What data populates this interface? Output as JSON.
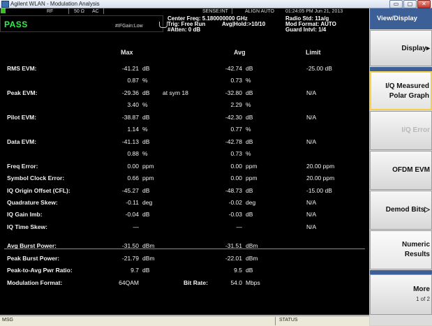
{
  "window": {
    "title": "Agilent WLAN - Modulation Analysis",
    "btn_min": "▭",
    "btn_max": "▢",
    "btn_close": "✕"
  },
  "header": {
    "rf": "RF",
    "impedance": "50 Ω",
    "coupling": "AC",
    "sense": "SENSE:INT",
    "align": "ALIGN AUTO",
    "datetime": "01:24:05 PM Jun 21, 2013",
    "pass_text": "PASS",
    "if_gain": "#IFGain:Low",
    "center_freq": "Center Freq: 5.180000000 GHz",
    "trig": "Trig: Free Run",
    "avg_hold": "Avg|Hold:>10/10",
    "atten": "#Atten: 0 dB",
    "radio_std": "Radio Std: 11a/g",
    "mod_format": "Mod Format: AUTO",
    "guard": "Guard Intvl: 1/4",
    "accent_green": "#2ff04a"
  },
  "columns": {
    "max": "Max",
    "avg": "Avg",
    "limit": "Limit"
  },
  "rows": [
    {
      "label": "RMS EVM:",
      "max": "-41.21",
      "max_u": "dB",
      "avg": "-42.74",
      "avg_u": "dB",
      "limit": "-25.00 dB"
    },
    {
      "label": "",
      "max": "0.87",
      "max_u": "%",
      "avg": "0.73",
      "avg_u": "%",
      "limit": ""
    },
    {
      "label": "Peak EVM:",
      "max": "-29.36",
      "max_u": "dB",
      "extra": "at   sym   18",
      "avg": "-32.80",
      "avg_u": "dB",
      "limit": "N/A"
    },
    {
      "label": "",
      "max": "3.40",
      "max_u": "%",
      "avg": "2.29",
      "avg_u": "%",
      "limit": ""
    },
    {
      "label": "Pilot EVM:",
      "max": "-38.87",
      "max_u": "dB",
      "avg": "-42.30",
      "avg_u": "dB",
      "limit": "N/A"
    },
    {
      "label": "",
      "max": "1.14",
      "max_u": "%",
      "avg": "0.77",
      "avg_u": "%",
      "limit": ""
    },
    {
      "label": "Data EVM:",
      "max": "-41.13",
      "max_u": "dB",
      "avg": "-42.78",
      "avg_u": "dB",
      "limit": "N/A"
    },
    {
      "label": "",
      "max": "0.88",
      "max_u": "%",
      "avg": "0.73",
      "avg_u": "%",
      "limit": ""
    },
    {
      "label": "Freq Error:",
      "max": "0.00",
      "max_u": "ppm",
      "avg": "0.00",
      "avg_u": "ppm",
      "limit": "20.00   ppm"
    },
    {
      "label": "Symbol Clock Error:",
      "max": "0.66",
      "max_u": "ppm",
      "avg": "0.00",
      "avg_u": "ppm",
      "limit": "20.00   ppm"
    },
    {
      "label": "IQ Origin Offset (CFL):",
      "max": "-45.27",
      "max_u": "dB",
      "avg": "-48.73",
      "avg_u": "dB",
      "limit": "-15.00 dB"
    },
    {
      "label": "Quadrature Skew:",
      "max": "-0.11",
      "max_u": "deg",
      "avg": "-0.02",
      "avg_u": "deg",
      "limit": "N/A"
    },
    {
      "label": "IQ Gain Imb:",
      "max": "-0.04",
      "max_u": "dB",
      "avg": "-0.03",
      "avg_u": "dB",
      "limit": "N/A"
    },
    {
      "label": "IQ Time Skew:",
      "max": "—",
      "max_u": "",
      "avg": "—",
      "avg_u": "",
      "limit": "N/A"
    },
    {
      "label": "Avg Burst Power:",
      "max": "-31.50",
      "max_u": "dBm",
      "avg": "-31.51",
      "avg_u": "dBm",
      "limit": ""
    },
    {
      "label": "Peak Burst Power:",
      "max": "-21.79",
      "max_u": "dBm",
      "avg": "-22.01",
      "avg_u": "dBm",
      "limit": ""
    },
    {
      "label": "Peak-to-Avg Pwr Ratio:",
      "max": "9.7",
      "max_u": "dB",
      "avg": "9.5",
      "avg_u": "dB",
      "limit": ""
    },
    {
      "label": "Modulation Format:",
      "max": "64QAM",
      "max_u": "",
      "bitrate_label": "Bit Rate:",
      "avg": "54.0",
      "avg_u": "Mbps",
      "limit": ""
    }
  ],
  "statusbar": {
    "msg": "MSG",
    "status": "STATUS"
  },
  "softkeys": {
    "title": "View/Display",
    "display": "Display▸",
    "iq_line1": "I/Q Measured",
    "iq_line2": "Polar Graph",
    "iq_error": "I/Q Error",
    "ofdm_evm": "OFDM EVM",
    "demod_bits": "Demod Bits▷",
    "numeric_line1": "Numeric",
    "numeric_line2": "Results",
    "more": "More",
    "more_page": "1 of 2",
    "accent_blue": "#3b5f96"
  }
}
